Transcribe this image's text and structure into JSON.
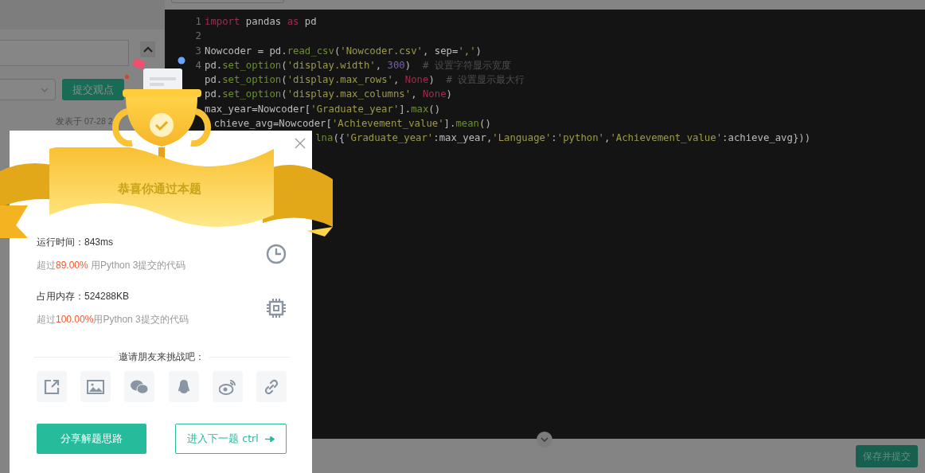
{
  "left_panel": {
    "submit_button": "提交观点",
    "posted": "发表于 07-28 2"
  },
  "editor": {
    "lines": [
      {
        "number": "1",
        "tokens": [
          {
            "kind": "keyword",
            "text": "import"
          },
          {
            "kind": "plain",
            "text": " pandas "
          },
          {
            "kind": "keyword",
            "text": "as"
          },
          {
            "kind": "plain",
            "text": " pd"
          }
        ]
      },
      {
        "number": "2"
      },
      {
        "number": "3",
        "tokens": [
          {
            "kind": "plain",
            "text": "Nowcoder = pd."
          },
          {
            "kind": "func",
            "text": "read_csv"
          },
          {
            "kind": "plain",
            "text": "("
          },
          {
            "kind": "string",
            "text": "'Nowcoder.csv'"
          },
          {
            "kind": "plain",
            "text": ", sep="
          },
          {
            "kind": "string",
            "text": "','"
          },
          {
            "kind": "plain",
            "text": ")"
          }
        ]
      },
      {
        "number": "4",
        "tokens": [
          {
            "kind": "plain",
            "text": "pd."
          },
          {
            "kind": "func",
            "text": "set_option"
          },
          {
            "kind": "plain",
            "text": "("
          },
          {
            "kind": "string",
            "text": "'display.width'"
          },
          {
            "kind": "plain",
            "text": ", "
          },
          {
            "kind": "number",
            "text": "300"
          },
          {
            "kind": "plain",
            "text": ")  "
          },
          {
            "kind": "comment",
            "text": "# 设置字符显示宽度"
          }
        ]
      },
      {
        "tokens": [
          {
            "kind": "plain",
            "text": "pd."
          },
          {
            "kind": "func",
            "text": "set_option"
          },
          {
            "kind": "plain",
            "text": "("
          },
          {
            "kind": "string",
            "text": "'display.max_rows'"
          },
          {
            "kind": "plain",
            "text": ", "
          },
          {
            "kind": "const",
            "text": "None"
          },
          {
            "kind": "plain",
            "text": ")  "
          },
          {
            "kind": "comment",
            "text": "# 设置显示最大行"
          }
        ]
      },
      {
        "tokens": [
          {
            "kind": "plain",
            "text": "pd."
          },
          {
            "kind": "func",
            "text": "set_option"
          },
          {
            "kind": "plain",
            "text": "("
          },
          {
            "kind": "string",
            "text": "'display.max_columns'"
          },
          {
            "kind": "plain",
            "text": ", "
          },
          {
            "kind": "const",
            "text": "None"
          },
          {
            "kind": "plain",
            "text": ")"
          }
        ]
      },
      {
        "tokens": [
          {
            "kind": "plain",
            "text": "max_year=Nowcoder["
          },
          {
            "kind": "string",
            "text": "'Graduate_year'"
          },
          {
            "kind": "plain",
            "text": "]."
          },
          {
            "kind": "func",
            "text": "max"
          },
          {
            "kind": "plain",
            "text": "()"
          }
        ]
      },
      {
        "tokens": [
          {
            "kind": "plain",
            "text": "chieve_avg=Nowcoder["
          },
          {
            "kind": "string",
            "text": "'Achievement_value'"
          },
          {
            "kind": "plain",
            "text": "]."
          },
          {
            "kind": "func",
            "text": "mean"
          },
          {
            "kind": "plain",
            "text": "()"
          }
        ]
      },
      {
        "tokens": [
          {
            "kind": "func",
            "text": "lna"
          },
          {
            "kind": "plain",
            "text": "({"
          },
          {
            "kind": "string",
            "text": "'Graduate_year'"
          },
          {
            "kind": "plain",
            "text": ":max_year,"
          },
          {
            "kind": "string",
            "text": "'Language'"
          },
          {
            "kind": "plain",
            "text": ":"
          },
          {
            "kind": "string",
            "text": "'python'"
          },
          {
            "kind": "plain",
            "text": ","
          },
          {
            "kind": "string",
            "text": "'Achievement_value'"
          },
          {
            "kind": "plain",
            "text": ":achieve_avg}))"
          }
        ]
      }
    ]
  },
  "footer": {
    "save_button": "保存并提交"
  },
  "dialog": {
    "title": "恭喜你通过本题",
    "stats": [
      {
        "kind": "time",
        "label": "运行时间：843ms",
        "before": "超过",
        "highlight": "89.00%",
        "after": " 用Python 3提交的代码"
      },
      {
        "kind": "memory",
        "label": "占用内存：524288KB",
        "before": "超过",
        "highlight": "100.00%",
        "after": "用Python 3提交的代码"
      }
    ],
    "invite": "邀请朋友来挑战吧：",
    "share": [
      {
        "kind": "external"
      },
      {
        "kind": "image"
      },
      {
        "kind": "wechat"
      },
      {
        "kind": "qq"
      },
      {
        "kind": "weibo"
      },
      {
        "kind": "link"
      }
    ],
    "buttons": [
      {
        "kind": "primary",
        "label": "分享解题思路"
      },
      {
        "kind": "secondary",
        "label": "进入下一题 ctrl"
      }
    ]
  }
}
